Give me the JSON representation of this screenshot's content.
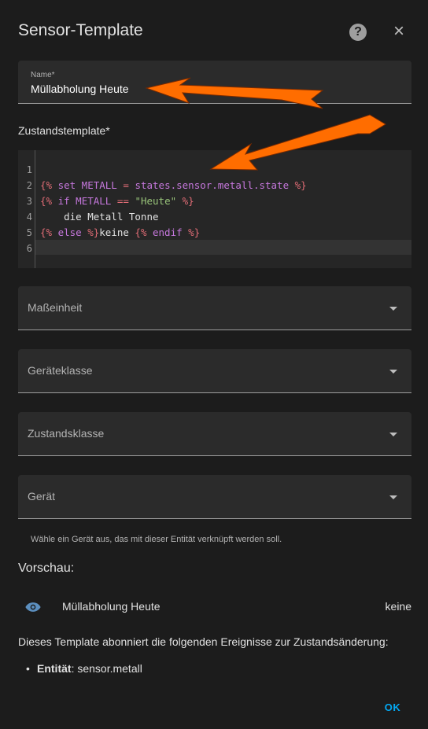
{
  "dialog": {
    "title": "Sensor-Template",
    "help_icon": "help-circle-icon",
    "close_icon": "close-icon",
    "close_glyph": "×",
    "help_glyph": "?"
  },
  "name_field": {
    "label": "Name*",
    "value": "Müllabholung Heute"
  },
  "template_section": {
    "label": "Zustandstemplate*"
  },
  "code_editor": {
    "line_numbers": [
      "1",
      "2",
      "3",
      "4",
      "5",
      "6"
    ],
    "lines": [
      [],
      [
        {
          "t": "{% ",
          "c": "op"
        },
        {
          "t": "set",
          "c": "kw"
        },
        {
          "t": " METALL ",
          "c": "kw"
        },
        {
          "t": "= ",
          "c": "op"
        },
        {
          "t": "states.sensor.metall.state",
          "c": "kw"
        },
        {
          "t": " %}",
          "c": "op"
        }
      ],
      [
        {
          "t": "{% ",
          "c": "op"
        },
        {
          "t": "if",
          "c": "kw"
        },
        {
          "t": " METALL ",
          "c": "kw"
        },
        {
          "t": "== ",
          "c": "op"
        },
        {
          "t": "\"Heute\"",
          "c": "str"
        },
        {
          "t": " %}",
          "c": "op"
        }
      ],
      [
        {
          "t": "    die Metall Tonne",
          "c": "txt"
        }
      ],
      [
        {
          "t": "{% ",
          "c": "op"
        },
        {
          "t": "else",
          "c": "kw"
        },
        {
          "t": " %}",
          "c": "op"
        },
        {
          "t": "keine ",
          "c": "txt"
        },
        {
          "t": "{% ",
          "c": "op"
        },
        {
          "t": "endif",
          "c": "kw"
        },
        {
          "t": " %}",
          "c": "op"
        }
      ],
      []
    ]
  },
  "selects": [
    {
      "label": "Maßeinheit"
    },
    {
      "label": "Geräteklasse"
    },
    {
      "label": "Zustandsklasse"
    },
    {
      "label": "Gerät"
    }
  ],
  "device_hint": "Wähle ein Gerät aus, das mit dieser Entität verknüpft werden soll.",
  "preview": {
    "title": "Vorschau:",
    "icon": "eye-icon",
    "entity_name": "Müllabholung Heute",
    "state": "keine",
    "events_text": "Dieses Template abonniert die folgenden Ereignisse zur Zustandsänderung:",
    "events": [
      {
        "label": "Entität",
        "value": ": sensor.metall"
      }
    ]
  },
  "actions": {
    "ok_label": "OK"
  },
  "colors": {
    "accent": "#03a9f4",
    "arrow": "#ff6d00",
    "background": "#1c1c1c",
    "field": "#2b2b2b"
  }
}
